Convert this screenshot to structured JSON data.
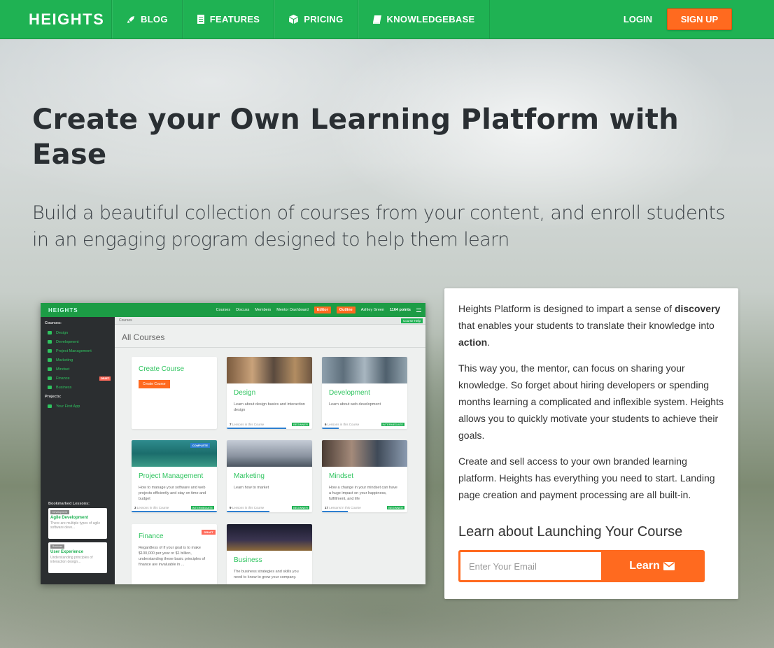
{
  "nav": {
    "brand": "HEIGHTS",
    "items": [
      {
        "label": "BLOG",
        "icon": "rocket-icon"
      },
      {
        "label": "FEATURES",
        "icon": "book-icon"
      },
      {
        "label": "PRICING",
        "icon": "cube-icon"
      },
      {
        "label": "KNOWLEDGEBASE",
        "icon": "knowledgebase-book-icon"
      }
    ],
    "login": "LOGIN",
    "signup": "SIGN UP"
  },
  "hero": {
    "title": "Create your Own Learning Platform with Ease",
    "subtitle": "Build a beautiful collection of courses from your content, and enroll students in an engaging program designed to help them learn"
  },
  "mockup": {
    "brand": "HEIGHTS",
    "links": [
      "Courses",
      "Discuss",
      "Members",
      "Mentor Dashboard"
    ],
    "editor": "Editor",
    "outline": "Outline",
    "user": "Ashley Green",
    "points": "1164 points",
    "sidebar_courses_heading": "Courses:",
    "sidebar_courses": [
      "Design",
      "Development",
      "Project Management",
      "Marketing",
      "Mindset",
      "Finance",
      "Business"
    ],
    "draft": "DRAFT",
    "sidebar_projects_heading": "Projects:",
    "sidebar_projects": [
      "Your First App"
    ],
    "bookmarks_heading": "Bookmarked Lessons:",
    "bookmarks": [
      {
        "tag": "Development",
        "title": "Agile Development",
        "desc": "There are multiple types of agile software deve..."
      },
      {
        "tag": "Business",
        "title": "User Experience",
        "desc": "Understanding principles of interaction design..."
      }
    ],
    "crumb": "Courses",
    "course_help": "Course Help",
    "all_courses": "All Courses",
    "create_title": "Create Course",
    "create_button": "Create Course",
    "complete": "COMPLETE",
    "cards": [
      {
        "title": "Design",
        "desc": "Learn about design basics and interaction design",
        "count": "7",
        "lessons": "Lessons in this Course",
        "level": "BEGINNER"
      },
      {
        "title": "Development",
        "desc": "Learn about web development",
        "count": "6",
        "lessons": "Lessons in this Course",
        "level": "INTERMEDIATE"
      },
      {
        "title": "Project Management",
        "desc": "How to manage your software and web projects efficiently and stay on time and budget",
        "count": "3",
        "lessons": "Lessons in this Course",
        "level": "INTERMEDIATE"
      },
      {
        "title": "Marketing",
        "desc": "Learn how to market",
        "count": "9",
        "lessons": "Lessons in this Course",
        "level": "BEGINNER"
      },
      {
        "title": "Mindset",
        "desc": "How a change in your mindset can have a huge impact on your happiness, fulfillment, and life",
        "count": "17",
        "lessons": "Lessons in this Course",
        "level": "BEGINNER"
      },
      {
        "title": "Finance",
        "desc": "Regardless of if your goal is to make $100,000 per year or $1 billion, understanding these basic principles of finance are invaluable in ...",
        "count": "",
        "lessons": "",
        "level": ""
      },
      {
        "title": "Business",
        "desc": "The business strategies and skills you need to know to grow your company.",
        "count": "",
        "lessons": "",
        "level": ""
      }
    ]
  },
  "panel": {
    "p1_a": "Heights Platform is designed to impart a sense of ",
    "p1_b": "discovery",
    "p1_c": " that enables your students to translate their knowledge into ",
    "p1_d": "action",
    "p1_e": ".",
    "p2": "This way you, the mentor, can focus on sharing your knowledge. So forget about hiring developers or spending months learning a complicated and inflexible system. Heights allows you to quickly motivate your students to achieve their goals.",
    "p3": "Create and sell access to your own branded learning platform. Heights has everything you need to start. Landing page creation and payment processing are all built-in.",
    "launch": "Learn about Launching Your Course",
    "email_placeholder": "Enter Your Email",
    "learn": "Learn"
  },
  "colors": {
    "brand_green": "#1fb253",
    "accent_orange": "#ff6a1f"
  }
}
